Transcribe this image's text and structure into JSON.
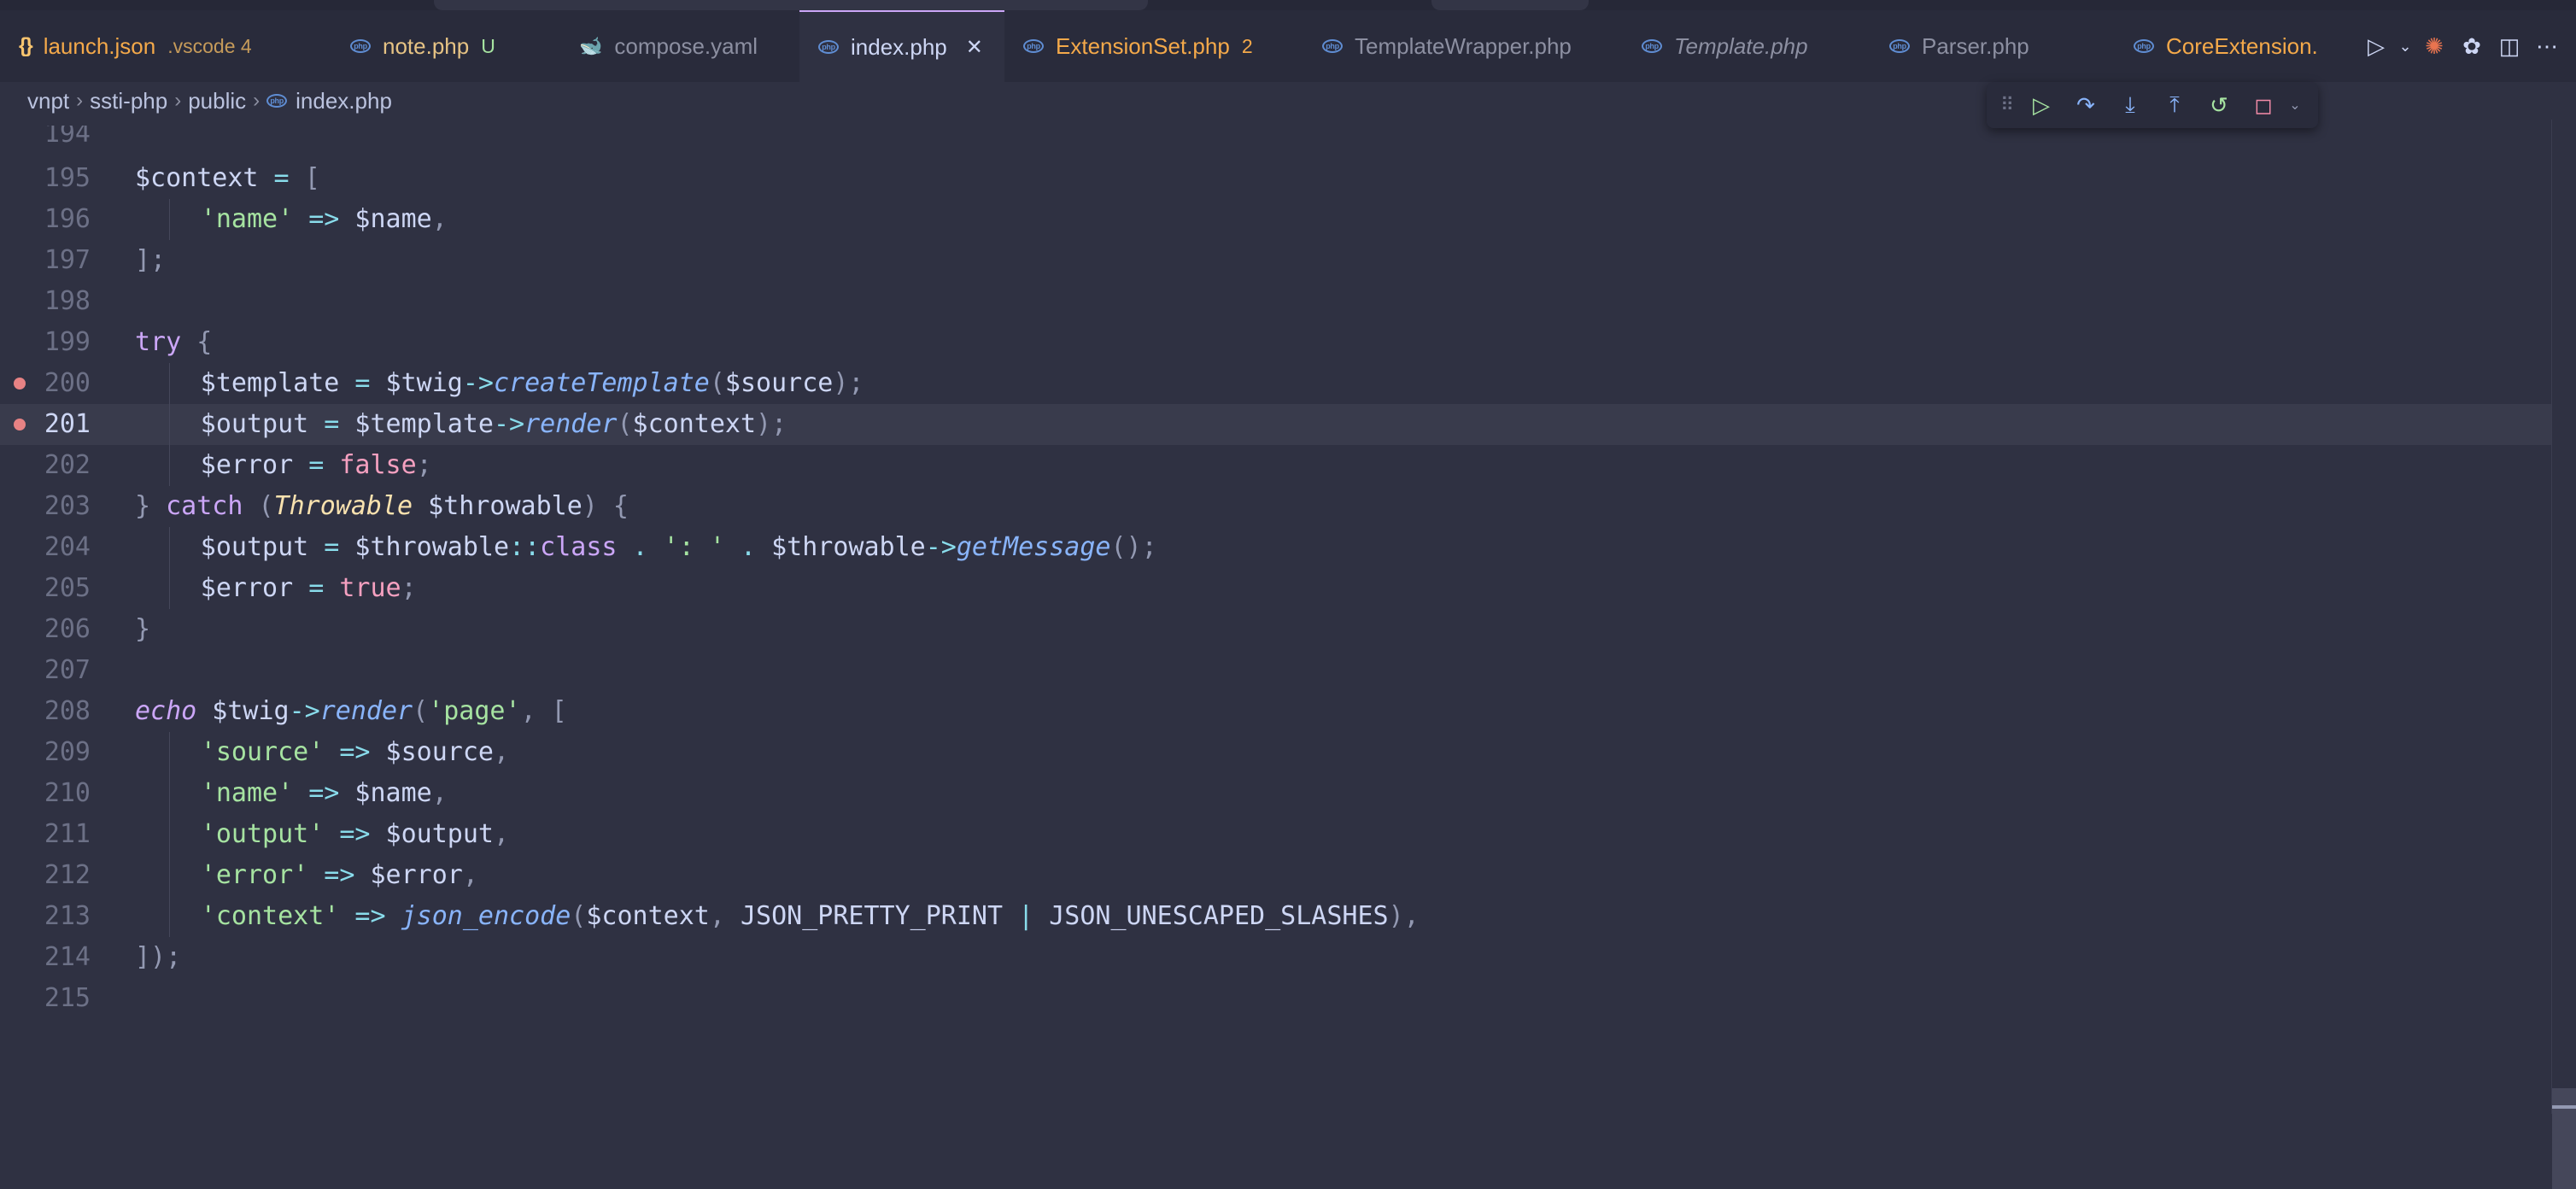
{
  "tabs": [
    {
      "label": "launch.json",
      "meta": ".vscode 4",
      "icon": "json-braces-icon",
      "color": "#f4a94a",
      "metaColor": "#c69b5a"
    },
    {
      "label": "note.php",
      "meta": "U",
      "icon": "php-icon",
      "color": "#e6c384",
      "metaColor": "#a6e3a1"
    },
    {
      "label": "compose.yaml",
      "meta": "",
      "icon": "docker-icon",
      "color": "#8c8fa1",
      "metaColor": ""
    },
    {
      "label": "index.php",
      "meta": "",
      "icon": "php-icon",
      "color": "#cdd6f4",
      "metaColor": "",
      "active": true
    },
    {
      "label": "ExtensionSet.php",
      "meta": "2",
      "icon": "php-icon",
      "color": "#f4a94a",
      "metaColor": "#f4a94a"
    },
    {
      "label": "TemplateWrapper.php",
      "meta": "",
      "icon": "php-icon",
      "color": "#8c8fa1",
      "metaColor": ""
    },
    {
      "label": "Template.php",
      "meta": "",
      "icon": "php-icon",
      "color": "#8c8fa1",
      "metaColor": "",
      "italic": true
    },
    {
      "label": "Parser.php",
      "meta": "",
      "icon": "php-icon",
      "color": "#8c8fa1",
      "metaColor": ""
    },
    {
      "label": "CoreExtension.",
      "meta": "",
      "icon": "php-icon",
      "color": "#f4a94a",
      "metaColor": ""
    }
  ],
  "breadcrumb": [
    "vnpt",
    "ssti-php",
    "public",
    "index.php"
  ],
  "editor": {
    "partial_top_line": "194",
    "current_line": "201",
    "lines": [
      {
        "num": "195",
        "bp": false,
        "indent": 0,
        "tokens": [
          [
            "$context",
            "t-var"
          ],
          [
            " = ",
            "t-op"
          ],
          [
            "[",
            "t-punc"
          ]
        ]
      },
      {
        "num": "196",
        "bp": false,
        "indent": 1,
        "tokens": [
          [
            "'name'",
            "t-str"
          ],
          [
            " => ",
            "t-op"
          ],
          [
            "$name",
            "t-var"
          ],
          [
            ",",
            "t-punc"
          ]
        ]
      },
      {
        "num": "197",
        "bp": false,
        "indent": 0,
        "tokens": [
          [
            "];",
            "t-punc"
          ]
        ]
      },
      {
        "num": "198",
        "bp": false,
        "indent": 0,
        "tokens": []
      },
      {
        "num": "199",
        "bp": false,
        "indent": 0,
        "tokens": [
          [
            "try",
            "t-kw"
          ],
          [
            " {",
            "t-punc"
          ]
        ]
      },
      {
        "num": "200",
        "bp": true,
        "indent": 1,
        "tokens": [
          [
            "$template",
            "t-var"
          ],
          [
            " = ",
            "t-op"
          ],
          [
            "$twig",
            "t-var"
          ],
          [
            "->",
            "t-op"
          ],
          [
            "createTemplate",
            "t-fn"
          ],
          [
            "(",
            "t-punc"
          ],
          [
            "$source",
            "t-var"
          ],
          [
            ");",
            "t-punc"
          ]
        ]
      },
      {
        "num": "201",
        "bp": true,
        "indent": 1,
        "tokens": [
          [
            "$output",
            "t-var"
          ],
          [
            " = ",
            "t-op"
          ],
          [
            "$template",
            "t-var"
          ],
          [
            "->",
            "t-op"
          ],
          [
            "render",
            "t-fn"
          ],
          [
            "(",
            "t-punc"
          ],
          [
            "$context",
            "t-var"
          ],
          [
            ");",
            "t-punc"
          ]
        ]
      },
      {
        "num": "202",
        "bp": false,
        "indent": 1,
        "tokens": [
          [
            "$error",
            "t-var"
          ],
          [
            " = ",
            "t-op"
          ],
          [
            "false",
            "t-bool"
          ],
          [
            ";",
            "t-punc"
          ]
        ]
      },
      {
        "num": "203",
        "bp": false,
        "indent": 0,
        "tokens": [
          [
            "} ",
            "t-punc"
          ],
          [
            "catch",
            "t-kw"
          ],
          [
            " (",
            "t-punc"
          ],
          [
            "Throwable",
            "t-cls"
          ],
          [
            " $throwable",
            "t-var"
          ],
          [
            ") {",
            "t-punc"
          ]
        ]
      },
      {
        "num": "204",
        "bp": false,
        "indent": 1,
        "tokens": [
          [
            "$output",
            "t-var"
          ],
          [
            " = ",
            "t-op"
          ],
          [
            "$throwable",
            "t-var"
          ],
          [
            "::",
            "t-op"
          ],
          [
            "class",
            "t-kw"
          ],
          [
            " . ",
            "t-op"
          ],
          [
            "': '",
            "t-str"
          ],
          [
            " . ",
            "t-op"
          ],
          [
            "$throwable",
            "t-var"
          ],
          [
            "->",
            "t-op"
          ],
          [
            "getMessage",
            "t-fn"
          ],
          [
            "();",
            "t-punc"
          ]
        ]
      },
      {
        "num": "205",
        "bp": false,
        "indent": 1,
        "tokens": [
          [
            "$error",
            "t-var"
          ],
          [
            " = ",
            "t-op"
          ],
          [
            "true",
            "t-bool"
          ],
          [
            ";",
            "t-punc"
          ]
        ]
      },
      {
        "num": "206",
        "bp": false,
        "indent": 0,
        "tokens": [
          [
            "}",
            "t-punc"
          ]
        ]
      },
      {
        "num": "207",
        "bp": false,
        "indent": 0,
        "tokens": []
      },
      {
        "num": "208",
        "bp": false,
        "indent": 0,
        "tokens": [
          [
            "echo",
            "t-kwi"
          ],
          [
            " $twig",
            "t-var"
          ],
          [
            "->",
            "t-op"
          ],
          [
            "render",
            "t-fn"
          ],
          [
            "(",
            "t-punc"
          ],
          [
            "'page'",
            "t-str"
          ],
          [
            ", [",
            "t-punc"
          ]
        ]
      },
      {
        "num": "209",
        "bp": false,
        "indent": 1,
        "tokens": [
          [
            "'source'",
            "t-str"
          ],
          [
            " => ",
            "t-op"
          ],
          [
            "$source",
            "t-var"
          ],
          [
            ",",
            "t-punc"
          ]
        ]
      },
      {
        "num": "210",
        "bp": false,
        "indent": 1,
        "tokens": [
          [
            "'name'",
            "t-str"
          ],
          [
            " => ",
            "t-op"
          ],
          [
            "$name",
            "t-var"
          ],
          [
            ",",
            "t-punc"
          ]
        ]
      },
      {
        "num": "211",
        "bp": false,
        "indent": 1,
        "tokens": [
          [
            "'output'",
            "t-str"
          ],
          [
            " => ",
            "t-op"
          ],
          [
            "$output",
            "t-var"
          ],
          [
            ",",
            "t-punc"
          ]
        ]
      },
      {
        "num": "212",
        "bp": false,
        "indent": 1,
        "tokens": [
          [
            "'error'",
            "t-str"
          ],
          [
            " => ",
            "t-op"
          ],
          [
            "$error",
            "t-var"
          ],
          [
            ",",
            "t-punc"
          ]
        ]
      },
      {
        "num": "213",
        "bp": false,
        "indent": 1,
        "tokens": [
          [
            "'context'",
            "t-str"
          ],
          [
            " => ",
            "t-op"
          ],
          [
            "json_encode",
            "t-fn"
          ],
          [
            "(",
            "t-punc"
          ],
          [
            "$context",
            "t-var"
          ],
          [
            ", ",
            "t-punc"
          ],
          [
            "JSON_PRETTY_PRINT",
            "t-const"
          ],
          [
            " | ",
            "t-op"
          ],
          [
            "JSON_UNESCAPED_SLASHES",
            "t-const"
          ],
          [
            "),",
            "t-punc"
          ]
        ]
      },
      {
        "num": "214",
        "bp": false,
        "indent": 0,
        "tokens": [
          [
            "]);",
            "t-punc"
          ]
        ]
      },
      {
        "num": "215",
        "bp": false,
        "indent": 0,
        "tokens": []
      }
    ]
  },
  "debug_toolbar": [
    "continue-icon",
    "step-over-icon",
    "step-into-icon",
    "step-out-icon",
    "restart-icon",
    "stop-icon"
  ],
  "editor_actions": [
    "run-icon",
    "run-dropdown-icon",
    "claude-icon",
    "openai-icon",
    "split-editor-icon",
    "more-actions-icon"
  ]
}
